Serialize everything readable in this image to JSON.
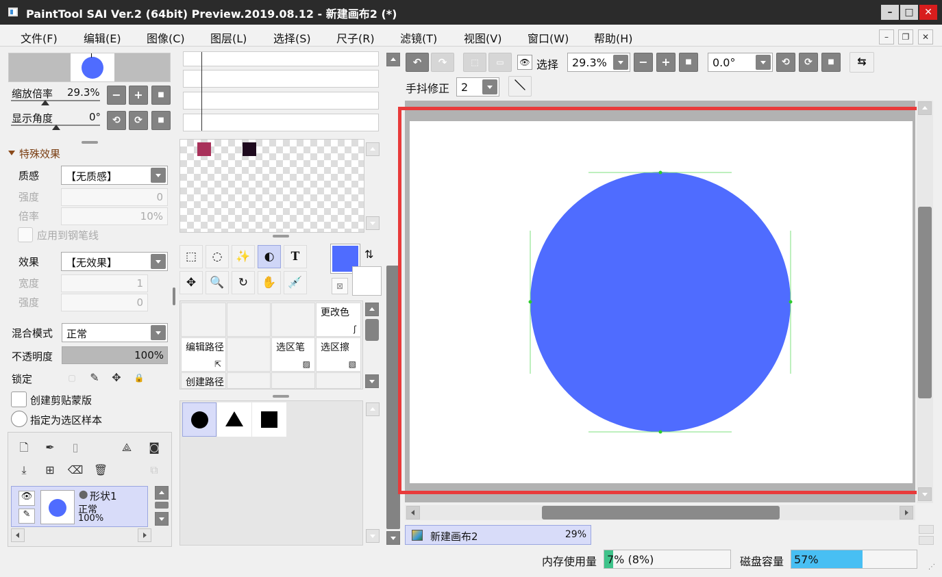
{
  "window": {
    "title": "PaintTool SAI Ver.2 (64bit) Preview.2019.08.12 - 新建画布2 (*)"
  },
  "menu": [
    "文件(F)",
    "编辑(E)",
    "图像(C)",
    "图层(L)",
    "选择(S)",
    "尺子(R)",
    "滤镜(T)",
    "视图(V)",
    "窗口(W)",
    "帮助(H)"
  ],
  "colors": {
    "accent_blue": "#4f6cff",
    "highlight_red": "#e83a3a",
    "swatch1": "#a8315a",
    "swatch2": "#1e0a1e",
    "memory_bar": "#3ec38a",
    "disk_bar": "#48bff3"
  },
  "navigator": {
    "zoom_label": "缩放倍率",
    "zoom_value": "29.3%",
    "angle_label": "显示角度",
    "angle_value": "0°"
  },
  "effects": {
    "section_title": "特殊效果",
    "texture_label": "质感",
    "texture_value": "【无质感】",
    "strength_label": "强度",
    "strength_value": "0",
    "scale_label": "倍率",
    "scale_value": "10%",
    "apply_pen_label": "应用到钢笔线",
    "effect_label": "效果",
    "effect_value": "【无效果】",
    "width_label": "宽度",
    "width_value": "1",
    "strength2_label": "强度",
    "strength2_value": "0"
  },
  "layer_props": {
    "blend_label": "混合模式",
    "blend_value": "正常",
    "opacity_label": "不透明度",
    "opacity_value": "100%",
    "opacity_fraction": 1.0,
    "lock_label": "锁定",
    "clip_label": "创建剪贴蒙版",
    "sample_label": "指定为选区样本"
  },
  "layer": {
    "name": "形状1",
    "mode": "正常",
    "opacity": "100%"
  },
  "brushes": {
    "change_color": "更改色",
    "edit_path": "编辑路径",
    "sel_pen": "选区笔",
    "sel_eraser": "选区擦",
    "create_path": "创建路径"
  },
  "toolbar": {
    "select_label": "选择",
    "zoom_value": "29.3%",
    "angle_value": "0.0°",
    "stabilizer_label": "手抖修正",
    "stabilizer_value": "2"
  },
  "tab": {
    "name": "新建画布2",
    "zoom": "29%"
  },
  "status": {
    "memory_label": "内存使用量",
    "memory_value": "7% (8%)",
    "memory_fraction": 0.07,
    "disk_label": "磁盘容量",
    "disk_value": "57%",
    "disk_fraction": 0.57
  },
  "icons": {
    "text_tool": "T"
  }
}
